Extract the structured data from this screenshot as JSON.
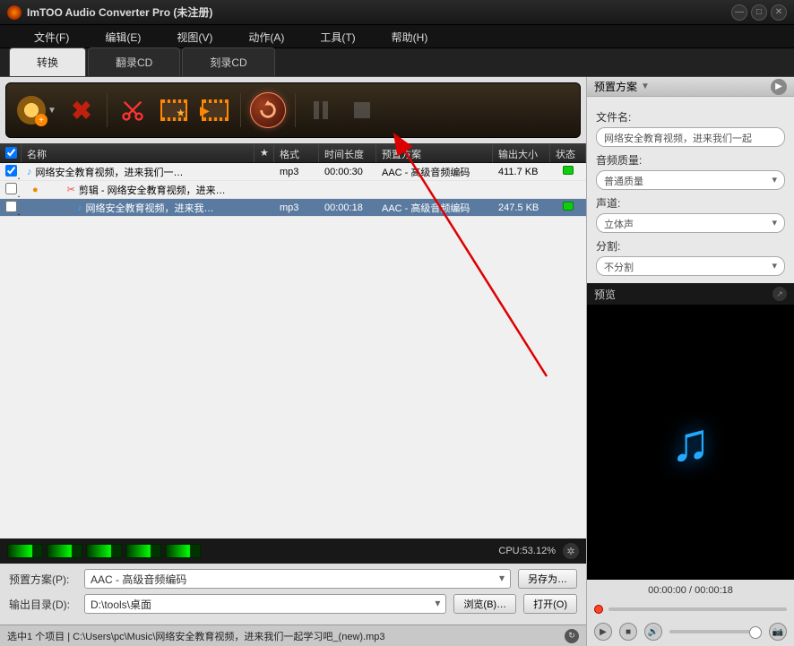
{
  "title": "ImTOO Audio Converter Pro (未注册)",
  "menu": [
    "文件(F)",
    "编辑(E)",
    "视图(V)",
    "动作(A)",
    "工具(T)",
    "帮助(H)"
  ],
  "tabs": {
    "items": [
      "转换",
      "翻录CD",
      "刻录CD"
    ],
    "active": 0
  },
  "columns": {
    "chk": "",
    "name": "名称",
    "star": "★",
    "fmt": "格式",
    "dur": "时间长度",
    "prof": "预置方案",
    "size": "输出大小",
    "stat": "状态"
  },
  "rows": [
    {
      "checked": true,
      "icon": "note",
      "indent": 0,
      "name": "网络安全教育视频，进来我们一…",
      "fmt": "mp3",
      "dur": "00:00:30",
      "prof": "AAC - 高级音频编码",
      "size": "411.7 KB",
      "status": "ready",
      "dark": false,
      "sel": false
    },
    {
      "checked": false,
      "icon": "cut",
      "indent": 1,
      "name": "剪辑 - 网络安全教育视频，进来…",
      "fmt": "",
      "dur": "",
      "prof": "",
      "size": "",
      "status": "",
      "dark": false,
      "sel": false,
      "bullet": true
    },
    {
      "checked": false,
      "icon": "note",
      "indent": 2,
      "name": "网络安全教育视频，进来我…",
      "fmt": "mp3",
      "dur": "00:00:18",
      "prof": "AAC - 高级音频编码",
      "size": "247.5 KB",
      "status": "ready",
      "dark": true,
      "sel": true
    }
  ],
  "cpu": "CPU:53.12%",
  "form": {
    "profile_lbl": "预置方案(P):",
    "profile_val": "AAC - 高级音频编码",
    "saveas": "另存为…",
    "out_lbl": "输出目录(D):",
    "out_val": "D:\\tools\\桌面",
    "browse": "浏览(B)…",
    "open": "打开(O)"
  },
  "status": "选中1 个项目 | C:\\Users\\pc\\Music\\网络安全教育视频，进来我们一起学习吧_(new).mp3",
  "right": {
    "header": "预置方案",
    "file_lbl": "文件名:",
    "file_val": "网络安全教育视频，进来我们一起",
    "quality_lbl": "音频质量:",
    "quality_val": "普通质量",
    "ch_lbl": "声道:",
    "ch_val": "立体声",
    "split_lbl": "分割:",
    "split_val": "不分割"
  },
  "preview": {
    "header": "预览",
    "time": "00:00:00 / 00:00:18"
  }
}
